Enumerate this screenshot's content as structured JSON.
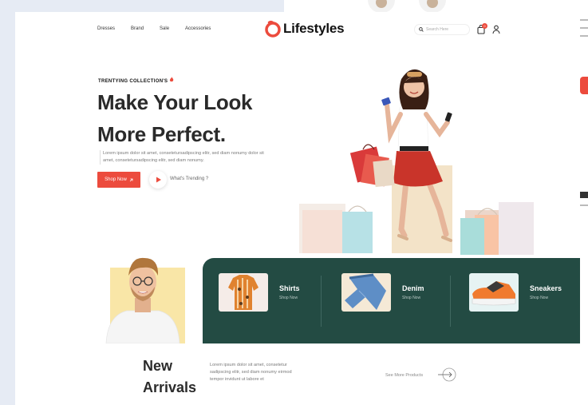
{
  "nav": {
    "items": [
      "Dresses",
      "Brand",
      "Sale",
      "Accessories"
    ]
  },
  "brand": {
    "name": "Lifestyles",
    "accent": "#ec4b3d"
  },
  "header": {
    "search_placeholder": "Search Here",
    "cart_count": "0"
  },
  "hero": {
    "eyebrow": "TRENTYING COLLECTION'S",
    "title_line1": "Make Your Look",
    "title_line2": "More Perfect.",
    "description": "Lorem ipsum dolor sit amet, consetetursadipscing elitr, sed diam nonumy dolor sit amet, consetetursadipscing elitr, sed diam nonumy.",
    "cta_label": "Shop Now",
    "video_label": "What's Trending ?"
  },
  "categories": [
    {
      "title": "Shirts",
      "link": "Shop Now"
    },
    {
      "title": "Denim",
      "link": "Shop Now"
    },
    {
      "title": "Sneakers",
      "link": "Shop Now"
    }
  ],
  "new_arrivals": {
    "title_line1": "New",
    "title_line2": "Arrivals",
    "description": "Lorem ipsum dolor sit amet, consetetur sadipscing elitr, sed diam nonumy eirmod tempor invidunt ut labore et",
    "see_more": "See More Products"
  },
  "colors": {
    "green_panel": "#234b43",
    "model_bg": "#f9e6a7",
    "page_bg": "#e6ebf4"
  },
  "icons": [
    "search-icon",
    "bag-icon",
    "user-icon",
    "play-icon",
    "arrow-right-icon",
    "flame-icon",
    "arrow-up-right-icon"
  ]
}
